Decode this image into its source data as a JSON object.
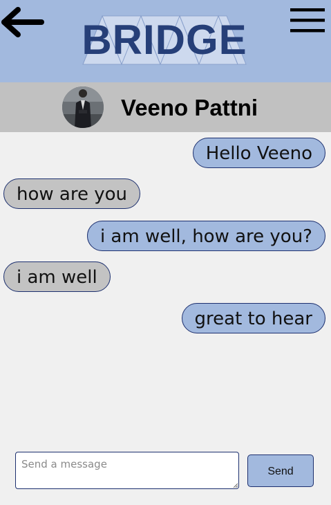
{
  "header": {
    "back_icon": "arrow-left-icon",
    "menu_icon": "hamburger-menu-icon",
    "logo_text": "BRIDGE",
    "colors": {
      "header_bg": "#a2b9de",
      "logo_text": "#263f78"
    }
  },
  "contact": {
    "name": "Veeno Pattni",
    "avatar_icon": "avatar-photo"
  },
  "messages": [
    {
      "text": "Hello Veeno",
      "direction": "sent"
    },
    {
      "text": "how are you",
      "direction": "received"
    },
    {
      "text": "i am well, how are you?",
      "direction": "sent"
    },
    {
      "text": "i am well",
      "direction": "received"
    },
    {
      "text": "great to hear",
      "direction": "sent"
    }
  ],
  "composer": {
    "placeholder": "Send a message",
    "value": "",
    "send_label": "Send"
  },
  "colors": {
    "sent_bubble": "#a2b9de",
    "received_bubble": "#c3c3c3",
    "bubble_border": "#1c2f6e",
    "page_bg": "#f0f0f0",
    "contact_bar_bg": "#c1c1c1"
  }
}
